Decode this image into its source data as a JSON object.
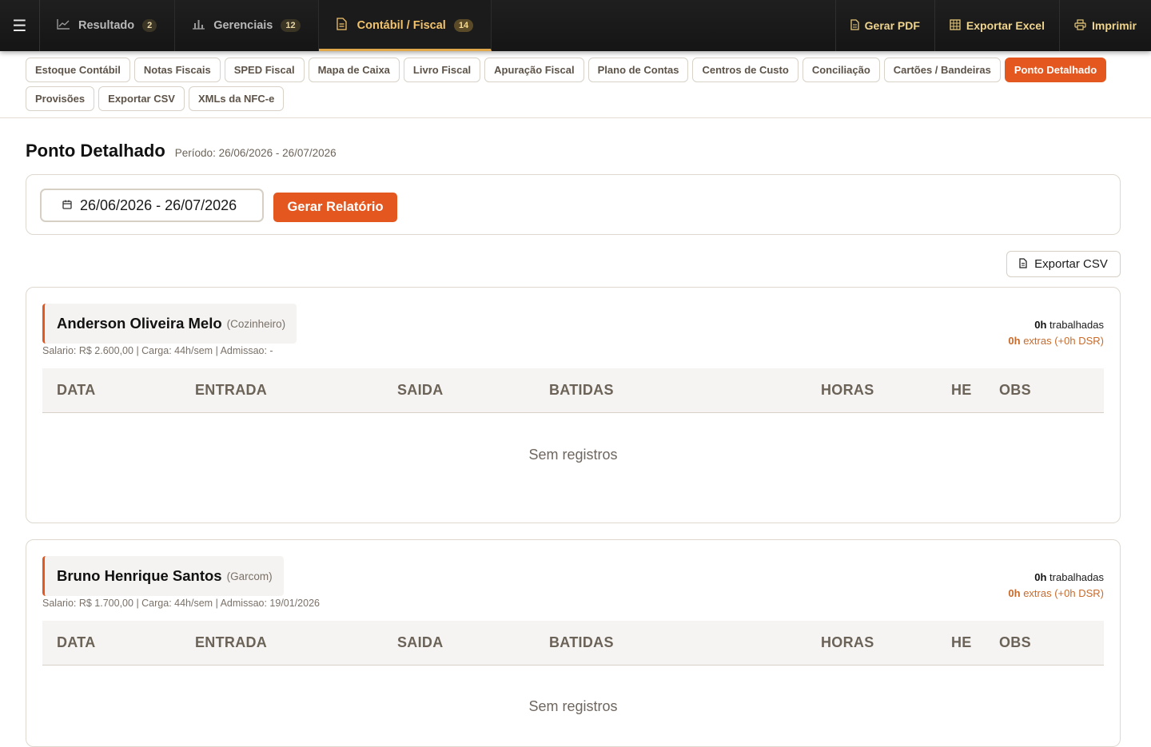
{
  "topbar": {
    "menu_icon": "hamburger-icon",
    "tabs": [
      {
        "label": "Resultado",
        "badge": "2",
        "icon": "line-chart-icon",
        "active": false
      },
      {
        "label": "Gerenciais",
        "badge": "12",
        "icon": "bar-chart-icon",
        "active": false
      },
      {
        "label": "Contábil / Fiscal",
        "badge": "14",
        "icon": "document-icon",
        "active": true
      }
    ],
    "actions": [
      {
        "label": "Gerar PDF",
        "icon": "pdf-file-icon"
      },
      {
        "label": "Exportar Excel",
        "icon": "table-grid-icon"
      },
      {
        "label": "Imprimir",
        "icon": "printer-icon"
      }
    ]
  },
  "subtabs": [
    {
      "label": "Estoque Contábil"
    },
    {
      "label": "Notas Fiscais"
    },
    {
      "label": "SPED Fiscal"
    },
    {
      "label": "Mapa de Caixa"
    },
    {
      "label": "Livro Fiscal"
    },
    {
      "label": "Apuração Fiscal"
    },
    {
      "label": "Plano de Contas"
    },
    {
      "label": "Centros de Custo"
    },
    {
      "label": "Conciliação"
    },
    {
      "label": "Cartões / Bandeiras"
    },
    {
      "label": "Ponto Detalhado",
      "active": true
    },
    {
      "label": "Provisões"
    },
    {
      "label": "Exportar CSV"
    },
    {
      "label": "XMLs da NFC-e"
    }
  ],
  "page": {
    "title": "Ponto Detalhado",
    "period": "Período: 26/06/2026 - 26/07/2026"
  },
  "filter": {
    "date_range": "26/06/2026 - 26/07/2026",
    "generate_label": "Gerar Relatório"
  },
  "export_csv_label": "Exportar CSV",
  "table_headers": [
    "DATA",
    "ENTRADA",
    "SAIDA",
    "BATIDAS",
    "HORAS",
    "HE",
    "OBS"
  ],
  "employees": [
    {
      "name": "Anderson Oliveira Melo",
      "role": "(Cozinheiro)",
      "meta": "Salario: R$ 2.600,00 | Carga: 44h/sem | Admissao: -",
      "hours_value": "0h",
      "hours_label": "trabalhadas",
      "extra_value": "0h",
      "extra_label": "extras (+0h DSR)",
      "empty_text": "Sem registros"
    },
    {
      "name": "Bruno Henrique Santos",
      "role": "(Garcom)",
      "meta": "Salario: R$ 1.700,00 | Carga: 44h/sem | Admissao: 19/01/2026",
      "hours_value": "0h",
      "hours_label": "trabalhadas",
      "extra_value": "0h",
      "extra_label": "extras (+0h DSR)",
      "empty_text": "Sem registros"
    }
  ],
  "colors": {
    "accent": "#e4571f",
    "topbar_bg": "#1a1a1a",
    "topbar_gold": "#f2c36b",
    "extra_text": "#c86a2a"
  }
}
